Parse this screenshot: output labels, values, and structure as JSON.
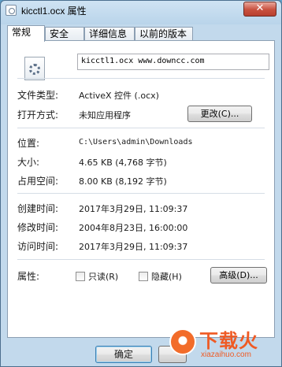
{
  "window": {
    "title": "kicctl1.ocx 属性",
    "close_symbol": "✕"
  },
  "tabs": [
    {
      "label": "常规",
      "active": true
    },
    {
      "label": "安全",
      "active": false
    },
    {
      "label": "详细信息",
      "active": false
    },
    {
      "label": "以前的版本",
      "active": false
    }
  ],
  "general": {
    "file_name": "kicctl1.ocx www.downcc.com",
    "file_type_label": "文件类型:",
    "file_type_value": "ActiveX 控件 (.ocx)",
    "opens_with_label": "打开方式:",
    "opens_with_value": "未知应用程序",
    "change_button": "更改(C)...",
    "location_label": "位置:",
    "location_value": "C:\\Users\\admin\\Downloads",
    "size_label": "大小:",
    "size_value": "4.65 KB (4,768 字节)",
    "size_on_disk_label": "占用空间:",
    "size_on_disk_value": "8.00 KB (8,192 字节)",
    "created_label": "创建时间:",
    "created_value": "2017年3月29日, 11:09:37",
    "modified_label": "修改时间:",
    "modified_value": "2004年8月23日, 16:00:00",
    "accessed_label": "访问时间:",
    "accessed_value": "2017年3月29日, 11:09:37",
    "attributes_label": "属性:",
    "readonly_label": "只读(R)",
    "readonly_checked": false,
    "hidden_label": "隐藏(H)",
    "hidden_checked": false,
    "advanced_button": "高级(D)..."
  },
  "footer": {
    "ok_button": "确定"
  },
  "watermark": {
    "name": "下载火",
    "url": "xiazaihuo.com",
    "color": "#ef5a24"
  }
}
